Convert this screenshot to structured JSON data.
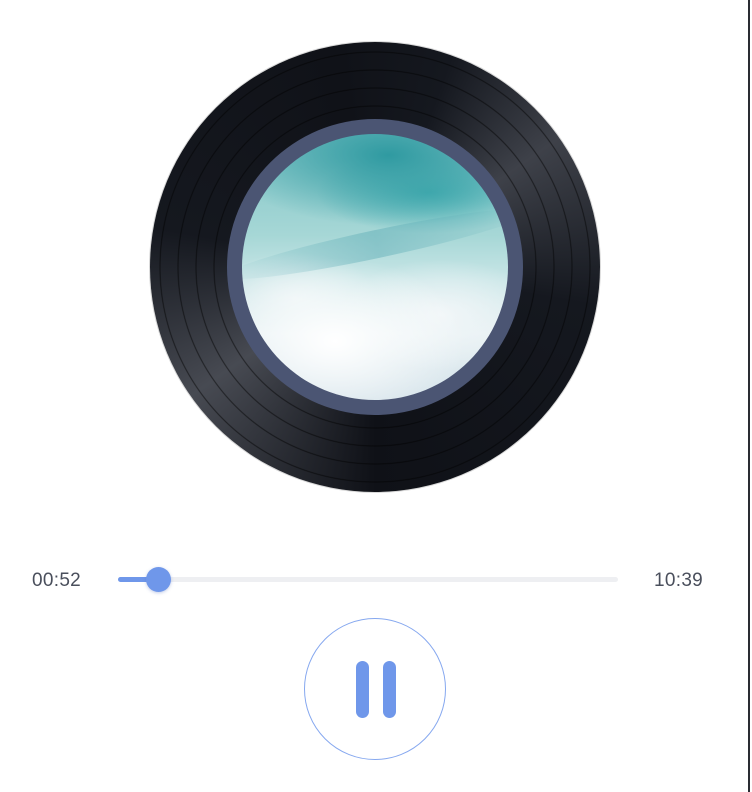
{
  "player": {
    "album_art": {
      "icon": "vinyl-record-icon",
      "cover": "sky-clouds-cover-art"
    },
    "progress": {
      "elapsed": "00:52",
      "total": "10:39",
      "fraction": 0.0798
    },
    "controls": {
      "state": "playing",
      "toggle_icon": "pause-icon"
    },
    "colors": {
      "accent": "#6f97ea",
      "track": "#eeeff2",
      "label_ring": "#4b5573",
      "text": "#4a4f5c"
    }
  }
}
